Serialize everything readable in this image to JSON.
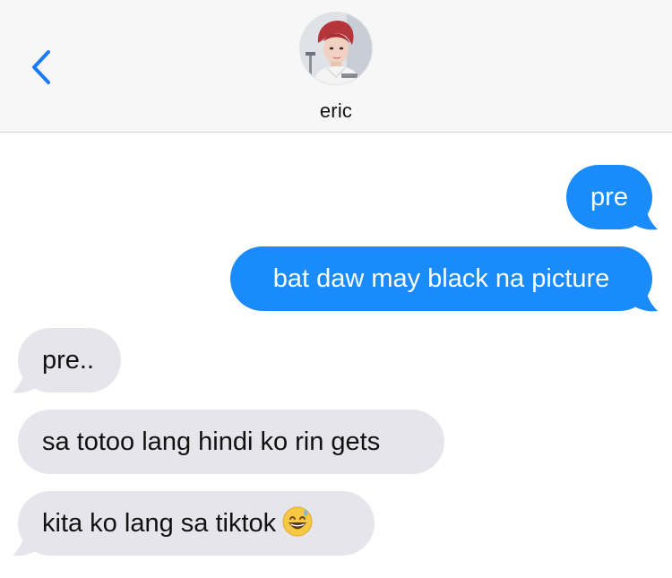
{
  "header": {
    "back_icon": "chevron-left-icon",
    "contact_name": "eric",
    "avatar_label": "contact photo"
  },
  "colors": {
    "sent_bubble": "#1a8bfa",
    "received_bubble": "#e6e5eb",
    "accent": "#1a7cf5",
    "header_background": "#f7f7f7"
  },
  "messages": [
    {
      "direction": "sent",
      "text": "pre"
    },
    {
      "direction": "sent",
      "text": "bat daw may black na picture"
    },
    {
      "direction": "received",
      "text": "pre.."
    },
    {
      "direction": "received",
      "text": "sa totoo lang hindi ko rin gets"
    },
    {
      "direction": "received",
      "text": "kita ko lang sa tiktok",
      "emoji": "grinning-sweat-emoji-icon"
    }
  ]
}
